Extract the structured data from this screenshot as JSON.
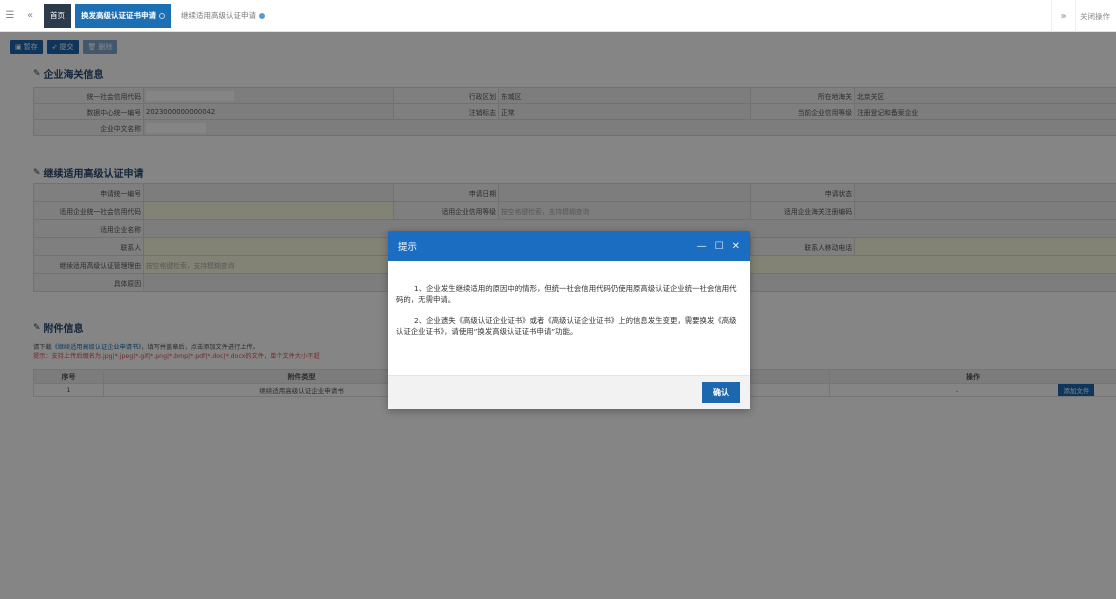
{
  "tabbar": {
    "menu_icon": "☰",
    "back_icon": "«",
    "tabs": [
      {
        "label": "首页"
      },
      {
        "label": "换发高级认证证书申请"
      },
      {
        "label": "继续适用高级认证申请"
      }
    ],
    "forward_icon": "»",
    "close_ops": "关闭操作"
  },
  "toolbar": {
    "save": "暂存",
    "submit": "提交",
    "delete": "删除"
  },
  "customs": {
    "title": "企业海关信息",
    "credit_code_label": "统一社会信用代码",
    "district_label": "行政区划",
    "district_value": "东城区",
    "customs_loc_label": "所在地海关",
    "customs_loc_value": "北京关区",
    "data_center_label": "数据中心统一编号",
    "data_center_value": "2023000000000042",
    "cancel_flag_label": "注销标志",
    "cancel_flag_value": "正常",
    "current_level_label": "当前企业信用等级",
    "current_level_value": "注册登记和备案企业",
    "cn_name_label": "企业中文名称"
  },
  "apply": {
    "title": "继续适用高级认证申请",
    "apply_no_label": "申请统一编号",
    "apply_date_label": "申请日期",
    "apply_status_label": "申请状态",
    "use_credit_code_label": "适用企业统一社会信用代码",
    "use_level_label": "适用企业信用等级",
    "use_level_hint": "按空格键检索，支持模糊查询",
    "use_reg_code_label": "适用企业海关注册编码",
    "use_name_label": "适用企业名称",
    "contact_label": "联系人",
    "contact_mobile_label": "联系人移动电话",
    "reason_label": "继续适用高级认证管理理由",
    "reason_hint": "按空格键检索，支持模糊查询",
    "detail_reason_label": "具体原因"
  },
  "attach": {
    "title": "附件信息",
    "desc_prefix": "请下载",
    "desc_link": "《继续适用高级认证企业申请书》",
    "desc_suffix": "，填写并盖章后，点击添加文件进行上传。",
    "warn": "提示：支持上传后缀名为.jpg|*.jpeg|*.gif|*.png|*.bmp|*.pdf|*.doc|*.docx的文件，单个文件大小不超",
    "col_no": "序号",
    "col_type": "附件类型",
    "col_op": "操作",
    "row_no": "1",
    "row_type": "继续适用高级认证企业申请书",
    "row_dash": "-",
    "add_file": "添加文件"
  },
  "dialog": {
    "title": "提示",
    "para1": "1、企业发生继续适用的原因中的情形，但统一社会信用代码仍使用原高级认证企业统一社会信用代码的，无需申请。",
    "para2": "2、企业遗失《高级认证企业证书》或者《高级认证企业证书》上的信息发生变更，需要换发《高级认证企业证书》，请使用“换发高级认证证书申请”功能。",
    "ok": "确认"
  }
}
